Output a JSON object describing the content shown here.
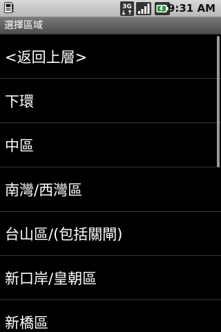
{
  "status_bar": {
    "time": "9:31 AM",
    "network_label": "3G",
    "icons": [
      "notification-icon",
      "3g-icon",
      "signal-icon",
      "battery-icon"
    ]
  },
  "title_bar": {
    "title": "選擇區域"
  },
  "list": {
    "items": [
      {
        "label": "<返回上層>"
      },
      {
        "label": "下環"
      },
      {
        "label": "中區"
      },
      {
        "label": "南灣/西灣區"
      },
      {
        "label": "台山區/(包括關閘)"
      },
      {
        "label": "新口岸/皇朝區"
      },
      {
        "label": "新橋區"
      }
    ]
  },
  "colors": {
    "background": "#000000",
    "text": "#ffffff",
    "divider": "#3a3a3a",
    "status_bar": "#c8c8c8",
    "title_bar": "#5e5e5e"
  }
}
